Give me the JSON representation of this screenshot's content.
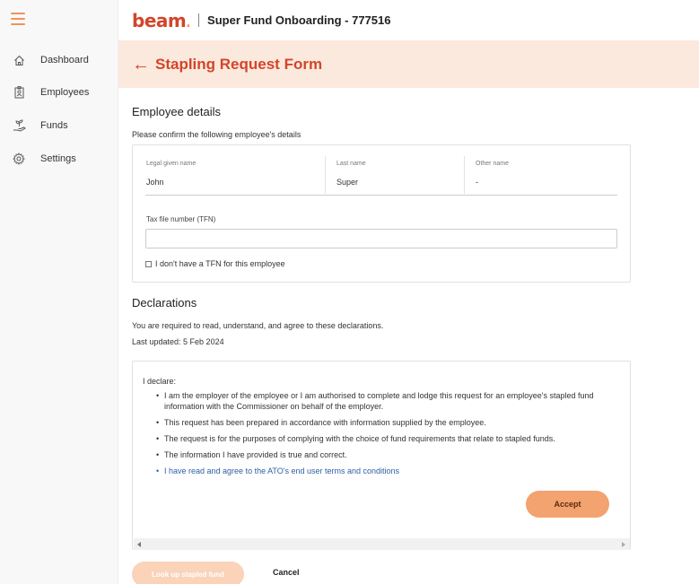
{
  "sidebar": {
    "items": [
      {
        "label": "Dashboard",
        "icon": "home-icon"
      },
      {
        "label": "Employees",
        "icon": "employee-badge-icon"
      },
      {
        "label": "Funds",
        "icon": "plant-hand-icon"
      },
      {
        "label": "Settings",
        "icon": "gear-icon"
      }
    ]
  },
  "header": {
    "logo_text": "beam",
    "logo_dot": ".",
    "app_title": "Super Fund Onboarding - 777516"
  },
  "page": {
    "back_arrow": "←",
    "title": "Stapling Request Form"
  },
  "employee": {
    "heading": "Employee details",
    "instruction": "Please confirm the following employee's details",
    "given_name_label": "Legal given name",
    "given_name_value": "John",
    "last_name_label": "Last name",
    "last_name_value": "Super",
    "other_name_label": "Other name",
    "other_name_value": "-",
    "tfn_label": "Tax file number (TFN)",
    "tfn_value": "",
    "no_tfn_label": "I don't have a TFN for this employee"
  },
  "declarations": {
    "heading": "Declarations",
    "instruction": "You are required to read, understand, and agree to these declarations.",
    "last_updated": "Last updated: 5 Feb 2024",
    "intro": "I declare:",
    "items": [
      "I am the employer of the employee or I am authorised to complete and lodge this request for an employee's stapled fund information with the Commissioner on behalf of the employer.",
      "This request has been prepared in accordance with information supplied by the employee.",
      "The request is for the purposes of complying with the choice of fund requirements that relate to stapled funds.",
      "The information I have provided is true and correct.",
      "I have read and agree to the ATO's end user terms and conditions"
    ],
    "accept_label": "Accept"
  },
  "footer": {
    "lookup_label": "Look up stapled fund",
    "cancel_label": "Cancel"
  },
  "colors": {
    "brand": "#d2452a",
    "accent": "#f3a36f",
    "title_bg": "#fce9dd",
    "link": "#2e5fa3"
  }
}
